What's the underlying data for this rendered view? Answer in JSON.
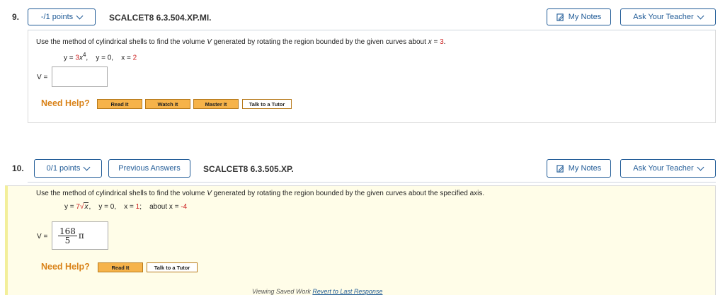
{
  "q9": {
    "number": "9.",
    "points": "-/1 points",
    "code": "SCALCET8 6.3.504.XP.MI.",
    "my_notes": "My Notes",
    "ask_teacher": "Ask Your Teacher",
    "prompt_pre": "Use the method of cylindrical shells to find the volume ",
    "prompt_var": "V",
    "prompt_mid": " generated by rotating the region bounded by the given curves about ",
    "prompt_axis_var": "x",
    "prompt_axis_eq": " = ",
    "prompt_axis_val": "3",
    "prompt_end": ".",
    "eq1_lhs": "y = ",
    "eq1_coef": "3",
    "eq1_var": "x",
    "eq1_exp": "4",
    "eq1_sep": ",",
    "eq2": "y = 0,",
    "eq3_lhs": "x = ",
    "eq3_val": "2",
    "v_label": "V =",
    "answer": "",
    "need_help": "Need Help?",
    "help_buttons": [
      "Read It",
      "Watch It",
      "Master It",
      "Talk to a Tutor"
    ]
  },
  "q10": {
    "number": "10.",
    "points": "0/1 points",
    "previous_answers": "Previous Answers",
    "code": "SCALCET8 6.3.505.XP.",
    "my_notes": "My Notes",
    "ask_teacher": "Ask Your Teacher",
    "prompt_pre": "Use the method of cylindrical shells to find the volume ",
    "prompt_var": "V",
    "prompt_post": " generated by rotating the region bounded by the given curves about the specified axis.",
    "eq1_lhs": "y = ",
    "eq1_coef": "7",
    "eq1_var": "x",
    "eq1_sep": ",",
    "eq2": "y = 0,",
    "eq3_lhs": "x = ",
    "eq3_val": "1",
    "eq3_sep": ";",
    "axis_lhs": "about x = ",
    "axis_val": "-4",
    "v_label": "V =",
    "answer_num": "168",
    "answer_den": "5",
    "answer_pi": "π",
    "need_help": "Need Help?",
    "help_buttons": [
      "Read It",
      "Talk to a Tutor"
    ],
    "footer_text": "Viewing Saved Work ",
    "footer_link": "Revert to Last Response"
  },
  "colors": {
    "accent": "#1f5a96",
    "help": "#d98218",
    "highlight": "#cc2020",
    "panel10_bg": "#fffde8"
  }
}
